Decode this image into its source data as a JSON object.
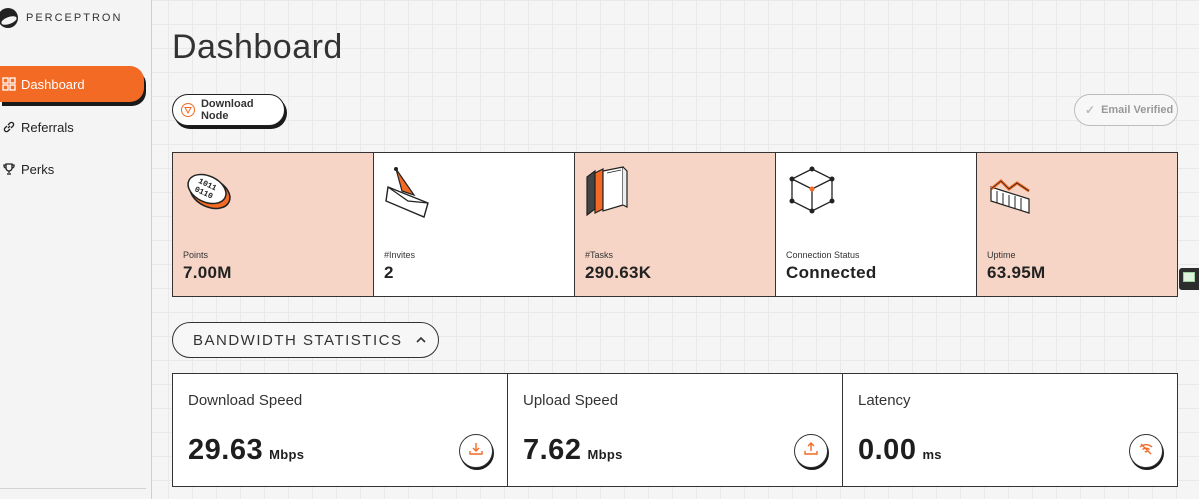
{
  "app": {
    "brand": "PERCEPTRON",
    "page_title": "Dashboard"
  },
  "sidebar": {
    "items": [
      {
        "label": "Dashboard",
        "icon": "grid-icon",
        "active": true
      },
      {
        "label": "Referrals",
        "icon": "link-icon",
        "active": false
      },
      {
        "label": "Perks",
        "icon": "trophy-icon",
        "active": false
      }
    ]
  },
  "header": {
    "download_node_label": "Download Node",
    "email_verified_label": "Email Verified"
  },
  "stats": [
    {
      "label": "Points",
      "value": "7.00M",
      "icon": "binary-disk-icon"
    },
    {
      "label": "#Invites",
      "value": "2",
      "icon": "envelope-icon"
    },
    {
      "label": "#Tasks",
      "value": "290.63K",
      "icon": "books-icon"
    },
    {
      "label": "Connection Status",
      "value": "Connected",
      "icon": "cube-network-icon"
    },
    {
      "label": "Uptime",
      "value": "63.95M",
      "icon": "chart-icon"
    }
  ],
  "bandwidth": {
    "title": "BANDWIDTH STATISTICS",
    "cards": [
      {
        "label": "Download Speed",
        "value": "29.63",
        "unit": "Mbps",
        "icon": "download-icon"
      },
      {
        "label": "Upload Speed",
        "value": "7.62",
        "unit": "Mbps",
        "icon": "upload-icon"
      },
      {
        "label": "Latency",
        "value": "0.00",
        "unit": "ms",
        "icon": "wifi-off-icon"
      }
    ]
  },
  "colors": {
    "accent": "#f26a24",
    "tint": "#f6d5c6",
    "border": "#333333"
  }
}
